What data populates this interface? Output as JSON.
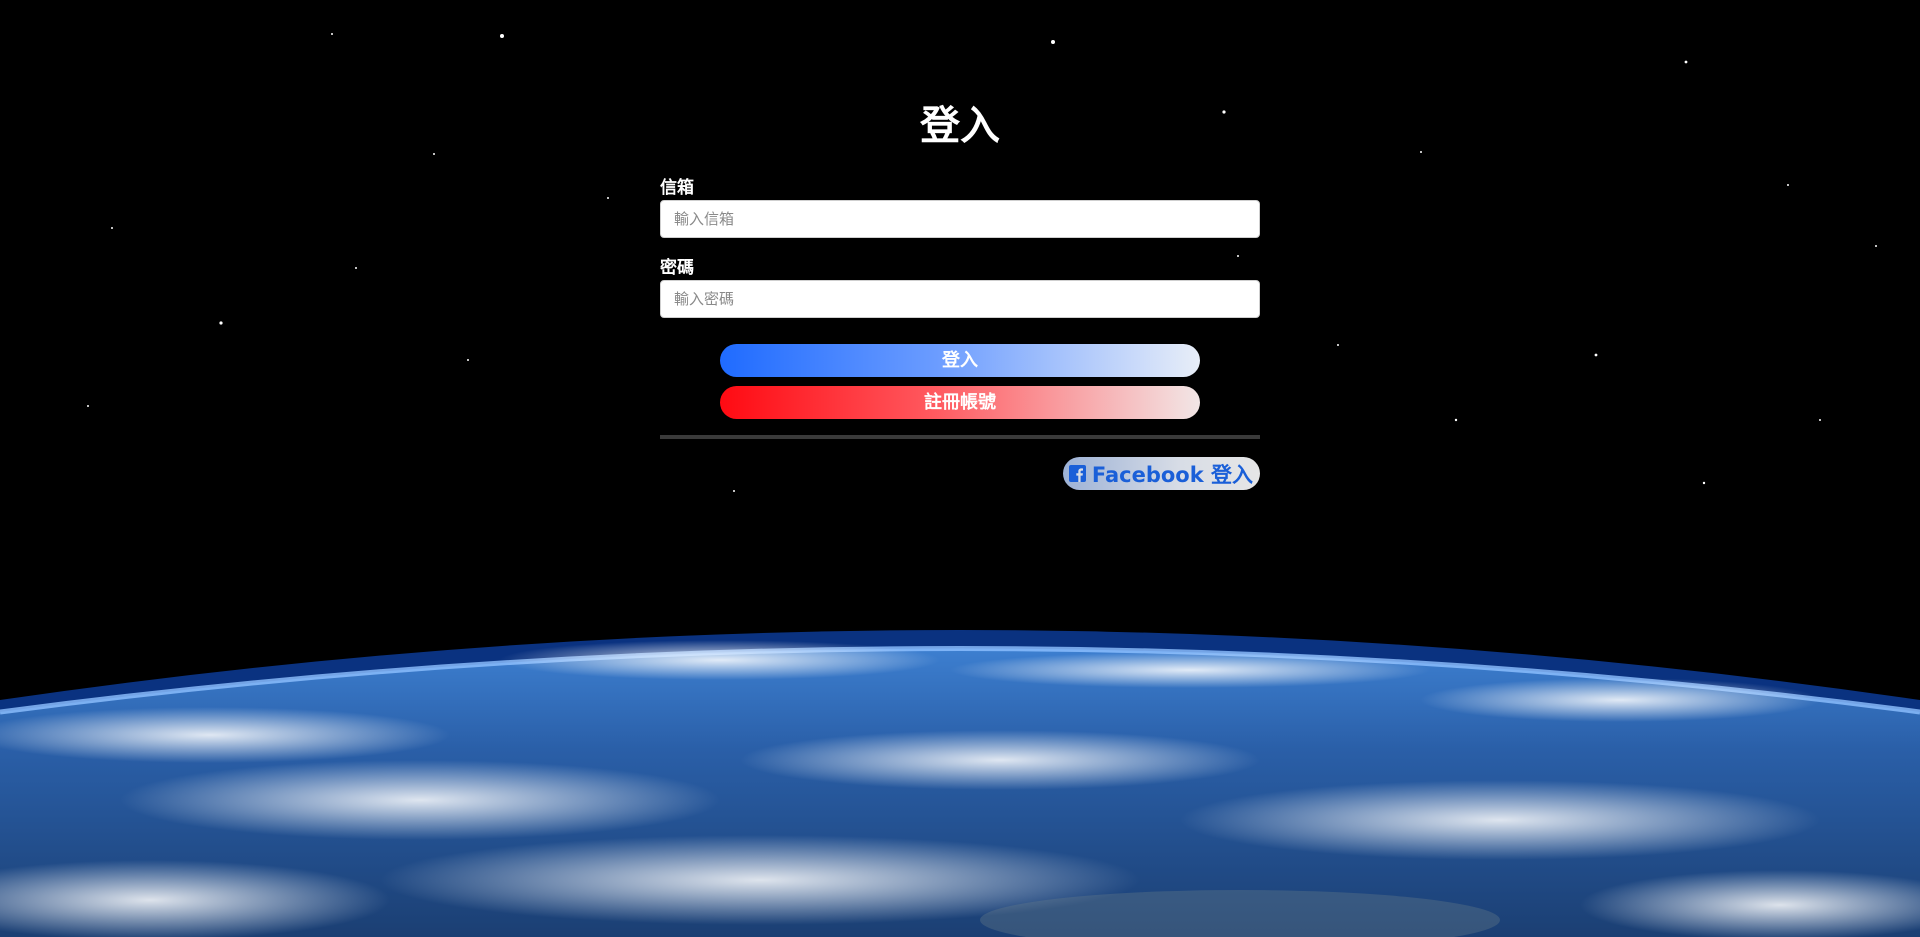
{
  "login": {
    "title": "登入",
    "email": {
      "label": "信箱",
      "placeholder": "輸入信箱",
      "value": ""
    },
    "password": {
      "label": "密碼",
      "placeholder": "輸入密碼",
      "value": ""
    },
    "login_button": "登入",
    "register_button": "註冊帳號",
    "facebook_button": "Facebook 登入"
  },
  "icons": {
    "facebook": "facebook-icon"
  },
  "colors": {
    "login_gradient_start": "#1f6bff",
    "register_gradient_start": "#ff0a12",
    "facebook_text": "#1a5fd8",
    "background": "#000000"
  }
}
